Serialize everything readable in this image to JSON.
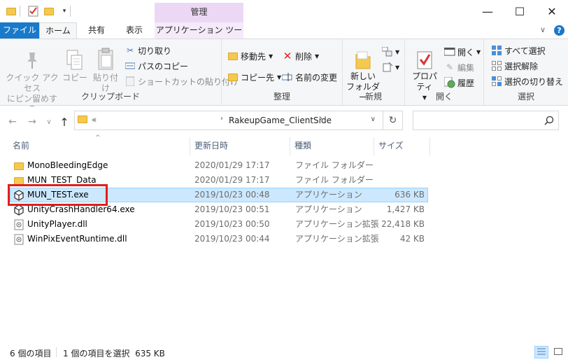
{
  "title_bar": {
    "context_group": "管理",
    "minimize": "—",
    "maximize": "☐",
    "close": "✕",
    "qat_icons": [
      "folder-icon",
      "properties-check-icon",
      "new-folder-icon",
      "qat-dropdown-icon"
    ]
  },
  "tabs": {
    "file": "ファイル",
    "home": "ホーム",
    "share": "共有",
    "view": "表示",
    "app_tools": "アプリケーション ツール",
    "collapse": "∨",
    "help": "?"
  },
  "ribbon": {
    "clipboard": {
      "label": "クリップボード",
      "pin_line1": "クイック アクセス",
      "pin_line2": "にピン留めする",
      "copy": "コピー",
      "paste": "貼り付け",
      "cut": "切り取り",
      "copy_path": "パスのコピー",
      "paste_shortcut": "ショートカットの貼り付け"
    },
    "organize": {
      "label": "整理",
      "move_to": "移動先",
      "copy_to": "コピー先",
      "delete": "削除",
      "rename": "名前の変更"
    },
    "new": {
      "label": "新規",
      "new_folder_line1": "新しい",
      "new_folder_line2": "フォルダー"
    },
    "open": {
      "label": "開く",
      "properties": "プロパティ",
      "open": "開く",
      "edit": "編集",
      "history": "履歴"
    },
    "select": {
      "label": "選択",
      "select_all": "すべて選択",
      "select_none": "選択解除",
      "invert": "選択の切り替え"
    }
  },
  "address": {
    "back": "←",
    "forward": "→",
    "recent": "∨",
    "up": "↑",
    "overflow": "«",
    "path": "RakeupGame_ClientSide",
    "refresh": "↻",
    "search_placeholder": ""
  },
  "columns": {
    "name": "名前",
    "date": "更新日時",
    "type": "種類",
    "size": "サイズ"
  },
  "files": [
    {
      "name": "MonoBleedingEdge",
      "date": "2020/01/29 17:17",
      "type": "ファイル フォルダー",
      "size": "",
      "icon": "folder-icon"
    },
    {
      "name": "MUN_TEST_Data",
      "date": "2020/01/29 17:17",
      "type": "ファイル フォルダー",
      "size": "",
      "icon": "folder-icon"
    },
    {
      "name": "MUN_TEST.exe",
      "date": "2019/10/23 00:48",
      "type": "アプリケーション",
      "size": "636 KB",
      "icon": "unity-icon"
    },
    {
      "name": "UnityCrashHandler64.exe",
      "date": "2019/10/23 00:51",
      "type": "アプリケーション",
      "size": "1,427 KB",
      "icon": "unity-icon"
    },
    {
      "name": "UnityPlayer.dll",
      "date": "2019/10/23 00:50",
      "type": "アプリケーション拡張",
      "size": "22,418 KB",
      "icon": "dll-icon"
    },
    {
      "name": "WinPixEventRuntime.dll",
      "date": "2019/10/23 00:44",
      "type": "アプリケーション拡張",
      "size": "42 KB",
      "icon": "dll-icon"
    }
  ],
  "selected_index": 2,
  "status": {
    "count": "6 個の項目",
    "selection": "1 個の項目を選択  635 KB"
  },
  "colors": {
    "file_tab": "#1979ca",
    "context_tab": "#ecd8f5",
    "selection": "#cce8ff",
    "highlight": "#e01e1e",
    "folder": "#f5c94d"
  }
}
